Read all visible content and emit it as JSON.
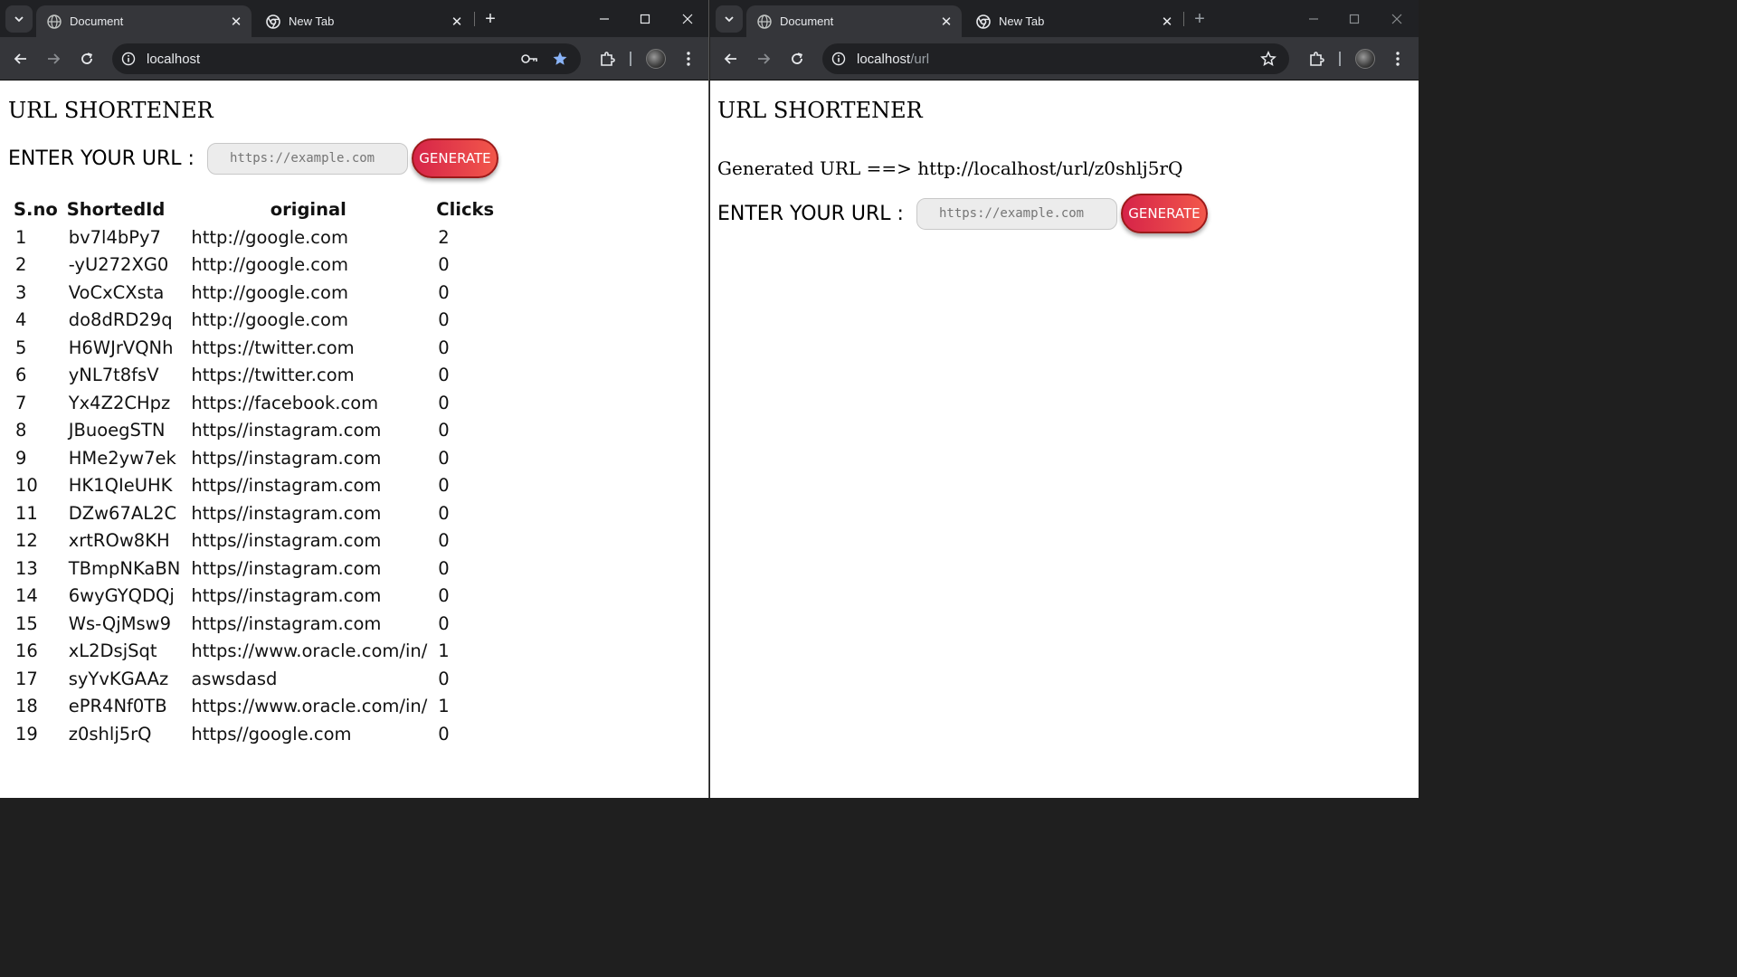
{
  "left_window": {
    "tabs": [
      {
        "title": "Document",
        "active": true
      },
      {
        "title": "New Tab",
        "active": false
      }
    ],
    "address": {
      "host": "localhost",
      "path": ""
    },
    "page": {
      "heading": "URL SHORTENER",
      "form_label": "ENTER YOUR URL :",
      "input_placeholder": "https://example.com",
      "button_label": "GENERATE",
      "table": {
        "headers": [
          "S.no",
          "ShortedId",
          "original",
          "Clicks"
        ],
        "rows": [
          [
            "1",
            "bv7l4bPy7",
            "http://google.com",
            "2"
          ],
          [
            "2",
            "-yU272XG0",
            "http://google.com",
            "0"
          ],
          [
            "3",
            "VoCxCXsta",
            "http://google.com",
            "0"
          ],
          [
            "4",
            "do8dRD29q",
            "http://google.com",
            "0"
          ],
          [
            "5",
            "H6WJrVQNh",
            "https://twitter.com",
            "0"
          ],
          [
            "6",
            "yNL7t8fsV",
            "https://twitter.com",
            "0"
          ],
          [
            "7",
            "Yx4Z2CHpz",
            "https://facebook.com",
            "0"
          ],
          [
            "8",
            "JBuoegSTN",
            "https//instagram.com",
            "0"
          ],
          [
            "9",
            "HMe2yw7ek",
            "https//instagram.com",
            "0"
          ],
          [
            "10",
            "HK1QIeUHK",
            "https//instagram.com",
            "0"
          ],
          [
            "11",
            "DZw67AL2C",
            "https//instagram.com",
            "0"
          ],
          [
            "12",
            "xrtROw8KH",
            "https//instagram.com",
            "0"
          ],
          [
            "13",
            "TBmpNKaBN",
            "https//instagram.com",
            "0"
          ],
          [
            "14",
            "6wyGYQDQj",
            "https//instagram.com",
            "0"
          ],
          [
            "15",
            "Ws-QjMsw9",
            "https//instagram.com",
            "0"
          ],
          [
            "16",
            "xL2DsjSqt",
            "https://www.oracle.com/in/",
            "1"
          ],
          [
            "17",
            "syYvKGAAz",
            "aswsdasd",
            "0"
          ],
          [
            "18",
            "ePR4Nf0TB",
            "https://www.oracle.com/in/",
            "1"
          ],
          [
            "19",
            "z0shlj5rQ",
            "https//google.com",
            "0"
          ]
        ]
      }
    }
  },
  "right_window": {
    "tabs": [
      {
        "title": "Document",
        "active": true
      },
      {
        "title": "New Tab",
        "active": false
      }
    ],
    "address": {
      "host": "localhost",
      "path": "/url"
    },
    "page": {
      "heading": "URL SHORTENER",
      "generated_text": "Generated URL ==> http://localhost/url/z0shlj5rQ",
      "form_label": "ENTER YOUR URL :",
      "input_placeholder": "https://example.com",
      "button_label": "GENERATE"
    }
  },
  "icons": {
    "tab_search": "chevron-down-icon",
    "favicon_document": "globe-icon",
    "favicon_newtab": "chrome-icon",
    "close": "close-icon",
    "new_tab": "plus-icon",
    "minimize": "minimize-icon",
    "maximize": "maximize-icon",
    "window_close": "close-icon",
    "back": "arrow-left-icon",
    "forward": "arrow-right-icon",
    "reload": "reload-icon",
    "site_info": "info-icon",
    "password_key": "key-icon",
    "bookmark_filled": "star-icon",
    "bookmark_outline": "star-outline-icon",
    "extensions": "puzzle-icon",
    "menu": "kebab-menu-icon"
  },
  "colors": {
    "chrome_frame": "#202124",
    "toolbar": "#35363a",
    "button_gradient_start": "#d62449",
    "button_gradient_end": "#f2574a",
    "bookmark_star": "#8ab4f8"
  }
}
